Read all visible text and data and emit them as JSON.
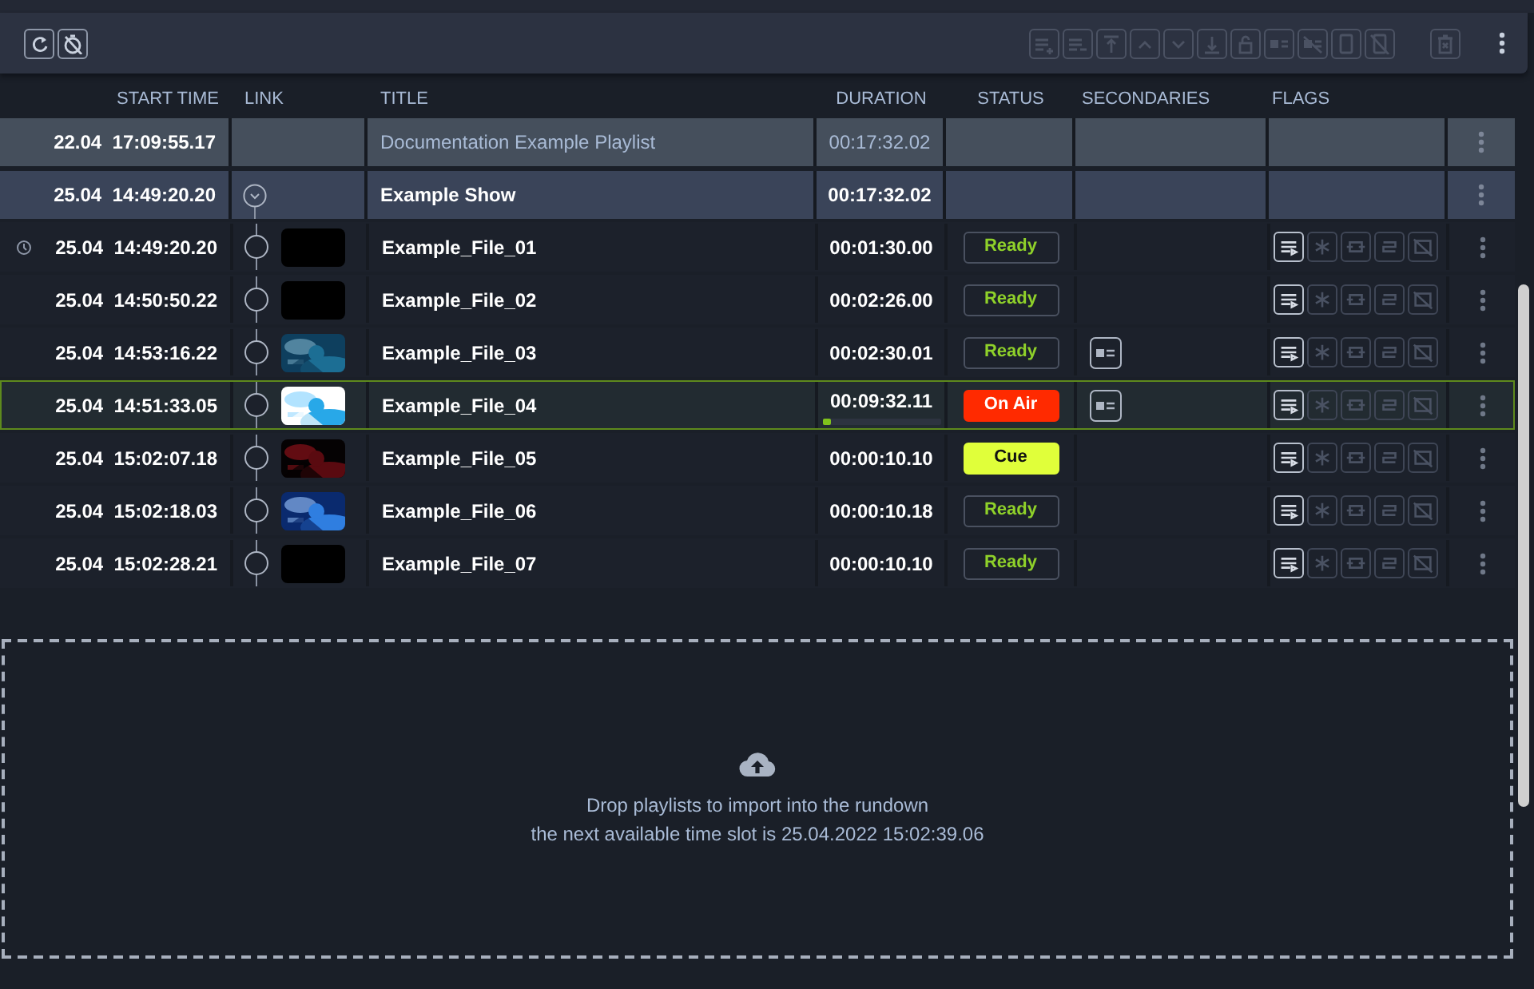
{
  "toolbar": {
    "left": [
      {
        "kind": "refresh",
        "disabled": false
      },
      {
        "kind": "timer-off",
        "disabled": false
      }
    ],
    "right": [
      {
        "kind": "add-after",
        "disabled": true
      },
      {
        "kind": "add-end",
        "disabled": true
      },
      {
        "kind": "to-top",
        "disabled": true
      },
      {
        "kind": "up",
        "disabled": true
      },
      {
        "kind": "down",
        "disabled": true
      },
      {
        "kind": "to-bottom",
        "disabled": true
      },
      {
        "kind": "lock",
        "disabled": true
      },
      {
        "kind": "secondary",
        "disabled": true
      },
      {
        "kind": "secondary-off",
        "disabled": true
      },
      {
        "kind": "script",
        "disabled": true
      },
      {
        "kind": "script-off",
        "disabled": true
      }
    ],
    "delete": {
      "disabled": true
    }
  },
  "columns": [
    "START TIME",
    "LINK",
    "TITLE",
    "DURATION",
    "STATUS",
    "SECONDARIES",
    "FLAGS"
  ],
  "flag_buttons": [
    {
      "kind": "playlist",
      "on": true
    },
    {
      "kind": "freeze",
      "on": false
    },
    {
      "kind": "loop",
      "on": false
    },
    {
      "kind": "swap",
      "on": false
    },
    {
      "kind": "no-video",
      "on": false
    }
  ],
  "rows": [
    {
      "kind": "playlist",
      "start": "22.04  17:09:55.17",
      "title": "Documentation Example Playlist",
      "duration": "00:17:32.02"
    },
    {
      "kind": "show",
      "start": "25.04  14:49:20.20",
      "title": "Example Show",
      "duration": "00:17:32.02",
      "expanded": true
    },
    {
      "kind": "item",
      "start": "25.04  14:49:20.20",
      "scheduled": true,
      "thumbnail": {
        "kind": "blank"
      },
      "title": "Example_File_01",
      "duration": "00:01:30.00",
      "status": {
        "text": "Ready",
        "kind": "ready"
      },
      "secondary": false,
      "selected": false
    },
    {
      "kind": "item",
      "start": "25.04  14:50:50.22",
      "scheduled": false,
      "thumbnail": {
        "kind": "blank"
      },
      "title": "Example_File_02",
      "duration": "00:02:26.00",
      "status": {
        "text": "Ready",
        "kind": "ready"
      },
      "secondary": false,
      "selected": false
    },
    {
      "kind": "item",
      "start": "25.04  14:53:16.22",
      "scheduled": false,
      "title": "Example_File_03",
      "duration": "00:02:30.01",
      "status": {
        "text": "Ready",
        "kind": "ready"
      },
      "secondary": true,
      "selected": false
    },
    {
      "kind": "item",
      "start": "25.04  14:51:33.05",
      "scheduled": false,
      "title": "Example_File_04",
      "duration": "00:09:32.11",
      "level": 0.08,
      "status": {
        "text": "On Air",
        "kind": "onair"
      },
      "secondary": true,
      "selected": true
    },
    {
      "kind": "item",
      "start": "25.04  15:02:07.18",
      "scheduled": false,
      "title": "Example_File_05",
      "duration": "00:00:10.10",
      "status": {
        "text": "Cue",
        "kind": "cue"
      },
      "secondary": false,
      "selected": false
    },
    {
      "kind": "item",
      "start": "25.04  15:02:18.03",
      "scheduled": false,
      "title": "Example_File_06",
      "duration": "00:00:10.18",
      "status": {
        "text": "Ready",
        "kind": "ready"
      },
      "secondary": false,
      "selected": false
    },
    {
      "kind": "item",
      "start": "25.04  15:02:28.21",
      "scheduled": false,
      "thumbnail": {
        "kind": "blank"
      },
      "title": "Example_File_07",
      "duration": "00:00:10.10",
      "status": {
        "text": "Ready",
        "kind": "ready"
      },
      "secondary": false,
      "selected": false
    }
  ],
  "drop_zone": {
    "lines": [
      "Drop playlists to import into the rundown",
      "the next available time slot is 25.04.2022 15:02:39.06"
    ]
  }
}
